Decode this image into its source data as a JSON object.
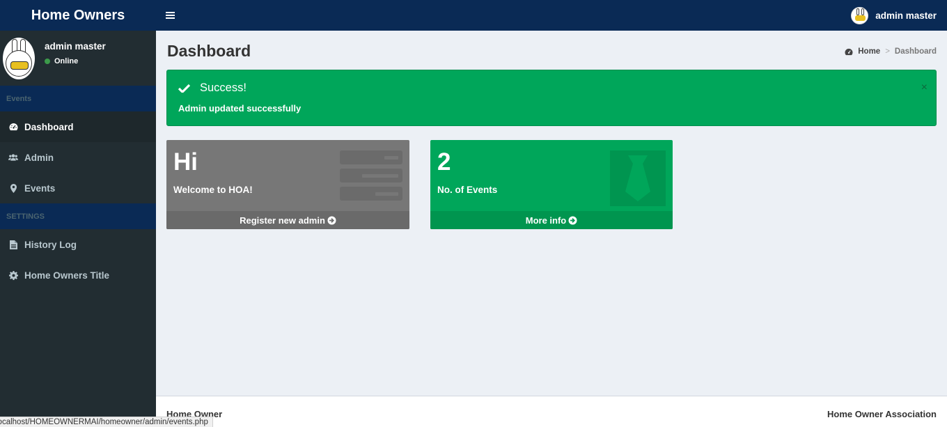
{
  "header": {
    "app_title": "Home Owners",
    "user_name": "admin master"
  },
  "sidebar": {
    "user_name": "admin master",
    "user_status": "Online",
    "sections": [
      {
        "header": "Events",
        "items": [
          {
            "label": "Dashboard",
            "icon": "dashboard-icon",
            "active": true
          },
          {
            "label": "Admin",
            "icon": "users-icon",
            "active": false
          },
          {
            "label": "Events",
            "icon": "map-marker-icon",
            "active": false
          }
        ]
      },
      {
        "header": "SETTINGS",
        "items": [
          {
            "label": "History Log",
            "icon": "file-icon",
            "active": false
          },
          {
            "label": "Home Owners Title",
            "icon": "gear-icon",
            "active": false
          }
        ]
      }
    ]
  },
  "main": {
    "page_title": "Dashboard",
    "breadcrumb": {
      "home": "Home",
      "current": "Dashboard"
    },
    "alert": {
      "title": "Success!",
      "message": "Admin updated successfully",
      "close": "×",
      "color": "#00a65a"
    },
    "boxes": [
      {
        "big": "Hi",
        "sub": "Welcome to HOA!",
        "link": "Register new admin",
        "color": "#777777",
        "icon": "list-icon"
      },
      {
        "big": "2",
        "sub": "No. of Events",
        "link": "More info",
        "color": "#00a65a",
        "icon": "tie-icon"
      }
    ]
  },
  "footer": {
    "left": "Home Owner",
    "right": "Home Owner Association"
  },
  "statusbar": {
    "url": "localhost/HOMEOWNERMAI/homeowner/admin/events.php"
  },
  "colors": {
    "header_bg": "#0a2a55",
    "sidebar_bg": "#222d32",
    "content_bg": "#ecf0f5"
  }
}
